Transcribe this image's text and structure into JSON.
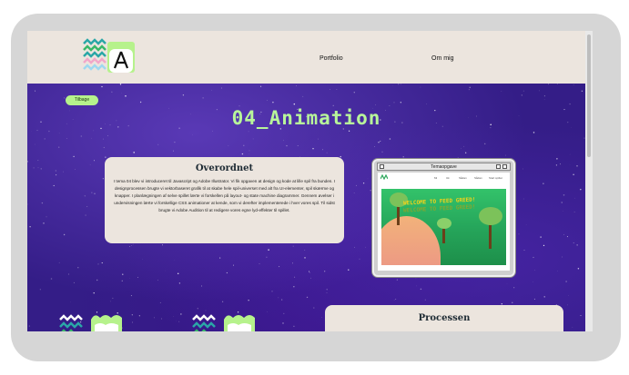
{
  "nav": {
    "portfolio": "Portfolio",
    "om_mig": "Om mig"
  },
  "page": {
    "back_label": "Tilbage",
    "title": "04_Animation"
  },
  "overview": {
    "heading": "Overordnet",
    "body": "I tema 04 blev vi introduceret til Javascript og Adobe Illustrator. Vi fik opgaven at design og kode at lille spil fra bunden. I designprocessen brugte vi vektorbaseret grafik til at skabe hele spil-universet med alt fra UI-elementer, spil skærme og knapper. I planlægningen af selve spillet lærte vi forskellen på layout- og state machine diagrammer. Gennem øvelser i undervisningen lærte vi forskellige CSS animationer at kende, som vi derefter implementerede i hver vores spil. Til sidst brugte vi Adobe Audition til at redigere vores egne lyd-effekter til spillet."
  },
  "screenshot_window": {
    "title": "Temaopgave",
    "mini_nav": [
      "Mi",
      "Uk",
      "Sådan",
      "Sådan",
      "Start spillet"
    ],
    "game_title": "WELCOME TO FEED GREED!"
  },
  "process": {
    "heading": "Processen"
  },
  "colors": {
    "header_bg": "#ece5de",
    "accent_green": "#b8f59a",
    "space_bg": "#341d87",
    "card_bg": "#ece5de"
  }
}
